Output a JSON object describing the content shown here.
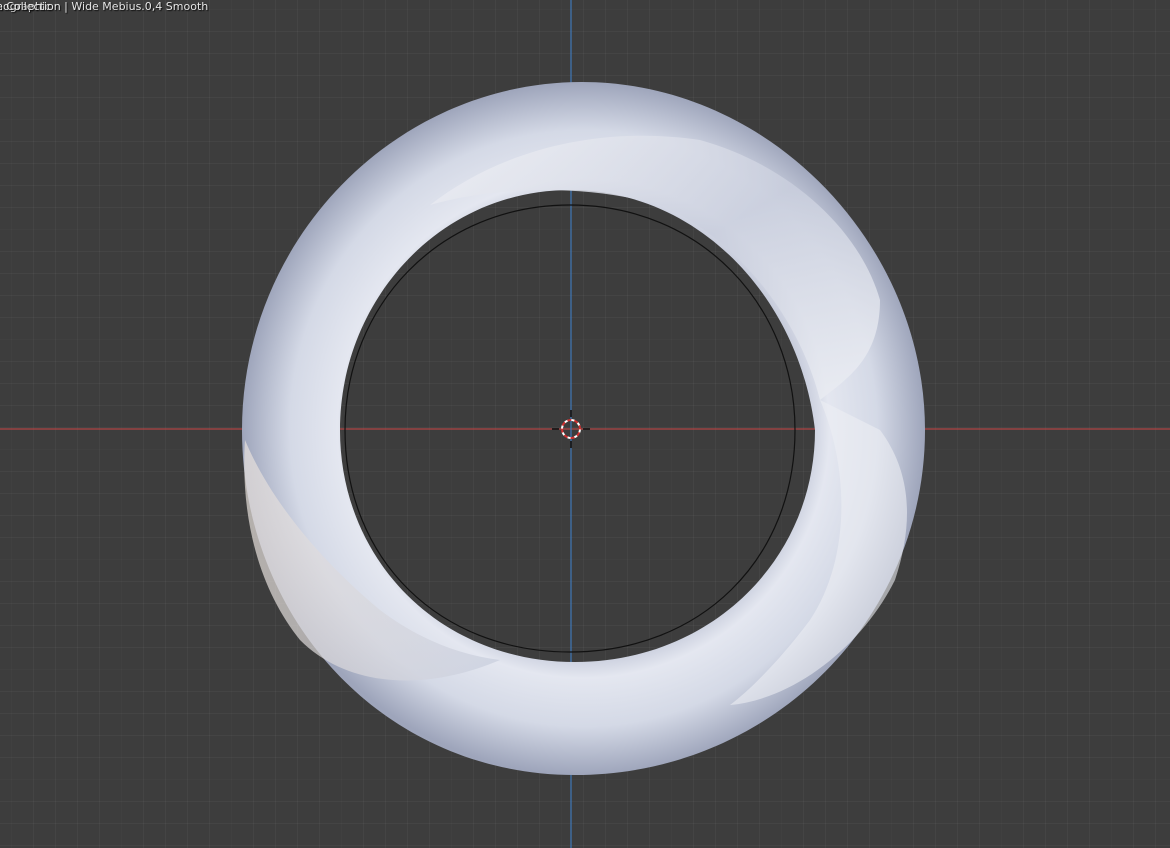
{
  "viewport": {
    "view_mode": "nographic",
    "collection_info": "e Collection | Wide Mebius.0,4 Smooth"
  },
  "colors": {
    "background": "#3d3d3d",
    "x_axis": "#b04444",
    "y_axis": "#3f78b8",
    "object": "#d9dde8",
    "text": "#e6e6e6"
  },
  "icons": {
    "cursor": "3d-cursor-icon"
  }
}
